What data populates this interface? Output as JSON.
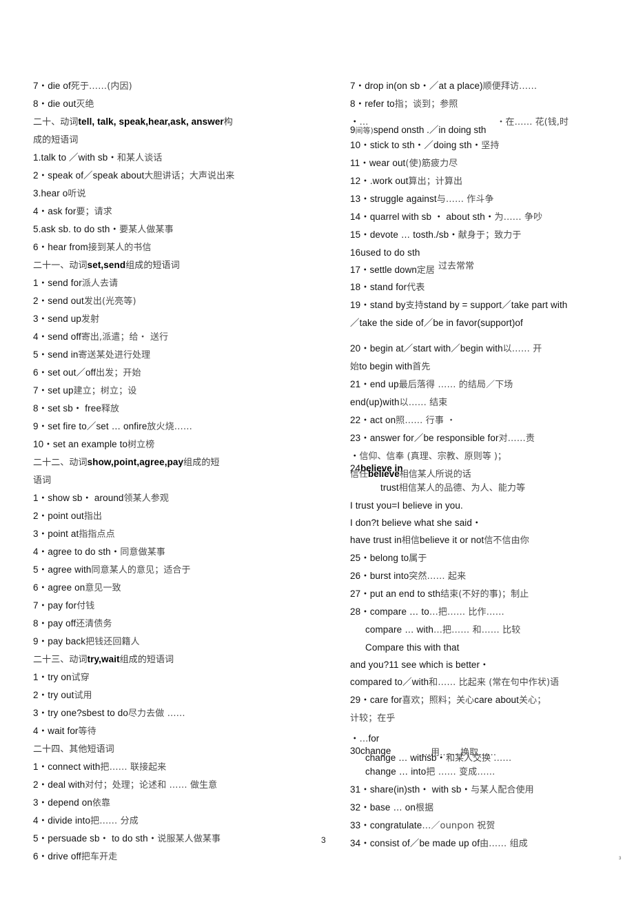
{
  "document": {
    "page_number": "3",
    "edge_marker": "3"
  },
  "left_column": [
    {
      "kind": "item",
      "num": "7・",
      "en": "die of",
      "cn": "死于……(内因)"
    },
    {
      "kind": "item",
      "num": "8・",
      "en": "die out",
      "cn": "灭绝"
    },
    {
      "kind": "heading",
      "cn_pre": "二十、动词",
      "bold": "tell, talk, speak,hear,ask, answer",
      "cn_post": "构"
    },
    {
      "kind": "heading_cont",
      "cn": "成的短语词"
    },
    {
      "kind": "item",
      "num": "1.",
      "en": "talk to ／with sb・",
      "cn": "和某人谈话"
    },
    {
      "kind": "item",
      "num": "2・",
      "en": "speak of／speak about",
      "cn": "大胆讲话；大声说出来"
    },
    {
      "kind": "item",
      "num": "3.",
      "en": "hear o",
      "cn": "听说"
    },
    {
      "kind": "item",
      "num": "4・",
      "en": "ask for",
      "cn": "要；请求"
    },
    {
      "kind": "item",
      "num": "5.",
      "en": "ask sb. to do sth・",
      "cn": "要某人做某事"
    },
    {
      "kind": "item",
      "num": "6・",
      "en": "hear from",
      "cn": "接到某人的书信"
    },
    {
      "kind": "heading",
      "cn_pre": "二十一、动词",
      "bold": "set,send",
      "cn_post": "组成的短语词"
    },
    {
      "kind": "item",
      "num": "1・",
      "en": "send for",
      "cn": "派人去请"
    },
    {
      "kind": "item",
      "num": "2・",
      "en": "send out",
      "cn": "发出(光亮等)"
    },
    {
      "kind": "item",
      "num": "3・",
      "en": "send up",
      "cn": "发射"
    },
    {
      "kind": "item",
      "num": "4・",
      "en": "send off",
      "cn": "寄出,派遣；给・ 送行"
    },
    {
      "kind": "item",
      "num": "5・",
      "en": "send in",
      "cn": "寄送某处进行处理"
    },
    {
      "kind": "item",
      "num": "6・",
      "en": "set out／off",
      "cn": "出发；开始"
    },
    {
      "kind": "item",
      "num": "7・",
      "en": "set up",
      "cn": "建立；树立；设"
    },
    {
      "kind": "item",
      "num": "8・",
      "en": "set sb・ free",
      "cn": "释放"
    },
    {
      "kind": "item",
      "num": "9・",
      "en": "set fire to／set … onfire",
      "cn": "放火烧……"
    },
    {
      "kind": "item",
      "num": "10・",
      "en": "set an example to",
      "cn": "树立榜"
    },
    {
      "kind": "heading",
      "cn_pre": "二十二、动词",
      "bold": "show,point,agree,pay",
      "cn_post": "组成的短"
    },
    {
      "kind": "heading_cont",
      "cn": "语词"
    },
    {
      "kind": "item",
      "num": "1・",
      "en": "show sb・ around",
      "cn": "领某人参观"
    },
    {
      "kind": "item",
      "num": "2・",
      "en": "point out",
      "cn": "指出"
    },
    {
      "kind": "item",
      "num": "3・",
      "en": "point at",
      "cn": "指指点点"
    },
    {
      "kind": "item",
      "num": "4・",
      "en": "agree to do sth・",
      "cn": "同意做某事"
    },
    {
      "kind": "item",
      "num": "5・",
      "en": "agree with",
      "cn": "同意某人的意见；适合于"
    },
    {
      "kind": "item",
      "num": "6・",
      "en": "agree on",
      "cn": "意见一致"
    },
    {
      "kind": "item",
      "num": "7・",
      "en": "pay for",
      "cn": "付钱"
    },
    {
      "kind": "item",
      "num": "8・",
      "en": "pay off",
      "cn": "还清债务"
    },
    {
      "kind": "item",
      "num": "9・",
      "en": "pay back",
      "cn": "把钱还回籍人"
    },
    {
      "kind": "heading",
      "cn_pre": "二十三、动词",
      "bold": "try,wait",
      "cn_post": "组成的短语词"
    },
    {
      "kind": "item",
      "num": "1・",
      "en": "try on",
      "cn": "试穿"
    },
    {
      "kind": "item",
      "num": "2・",
      "en": "try out",
      "cn": "试用"
    },
    {
      "kind": "item",
      "num": "3・",
      "en": "try one?sbest to do",
      "cn": "尽力去做 ……"
    },
    {
      "kind": "item",
      "num": "4・",
      "en": "wait for",
      "cn": "等待"
    },
    {
      "kind": "heading",
      "cn_pre": "二十四、其他短语词",
      "bold": "",
      "cn_post": ""
    },
    {
      "kind": "item",
      "num": "1・",
      "en": "connect with",
      "cn": "把…… 联接起来"
    },
    {
      "kind": "item",
      "num": "2・",
      "en": "deal with",
      "cn": "对付；处理；论述和 …… 做生意"
    },
    {
      "kind": "item",
      "num": "3・",
      "en": "depend on",
      "cn": "依靠"
    },
    {
      "kind": "item",
      "num": "4・",
      "en": "divide into",
      "cn": "把…… 分成"
    },
    {
      "kind": "item",
      "num": "5・",
      "en": "persuade sb・ to do sth・",
      "cn": "说服某人做某事"
    },
    {
      "kind": "item",
      "num": "6・",
      "en": "drive off",
      "cn": "把车开走"
    }
  ],
  "right_column": [
    {
      "kind": "item",
      "num": "7・",
      "en": "drop in(on sb・／at a place)",
      "cn": "顺便拜访……"
    },
    {
      "kind": "item",
      "num": "8・",
      "en": "refer to",
      "cn": "指；谈到；参照"
    },
    {
      "kind": "overlap",
      "top": {
        "dots": "・",
        "dots2": "…",
        "cn": "・在…… 花(钱,时"
      },
      "bottom": {
        "num": "9",
        "cn_small": "间等)",
        "en": "spend    onsth .／in doing sth"
      }
    },
    {
      "kind": "item",
      "num": "10・",
      "en": "stick to sth・／doing sth・",
      "cn": "坚持"
    },
    {
      "kind": "item",
      "num": "11・",
      "en": "wear out",
      "cn": "(使)筋疲力尽"
    },
    {
      "kind": "item",
      "num": "12・",
      "en": ".work out",
      "cn": "算出；计算出"
    },
    {
      "kind": "item",
      "num": "13・",
      "en": "struggle against",
      "cn": "与…… 作斗争"
    },
    {
      "kind": "item",
      "num": "14・",
      "en": "quarrel with sb ・ about sth・",
      "cn": "为…… 争吵"
    },
    {
      "kind": "item",
      "num": "15・",
      "en": "devote … tosth./sb・",
      "cn": "献身于；致力于"
    },
    {
      "kind": "item",
      "num": "16",
      "en": "used to do sth",
      "cn": ""
    },
    {
      "kind": "overlap17",
      "num": "17・",
      "en": "settle down",
      "cn_under": "定居",
      "cn_over": "过去常常"
    },
    {
      "kind": "item",
      "num": "18・",
      "en": "stand for",
      "cn": "代表"
    },
    {
      "kind": "item",
      "num": "19・",
      "en": "stand by",
      "cn": "支持",
      "en2": "stand by = support／take part with"
    },
    {
      "kind": "cont",
      "en": "／take the side of／be in favor(support)of"
    },
    {
      "kind": "gap"
    },
    {
      "kind": "item",
      "num": "20・",
      "en": "begin at／start with／begin with",
      "cn": "以…… 开"
    },
    {
      "kind": "cont2",
      "cn": "始",
      "en": "to begin with",
      "cn2": "首先"
    },
    {
      "kind": "item",
      "num": "21・",
      "en": "end up",
      "cn": "最后落得 …… 的结局／下场"
    },
    {
      "kind": "plain",
      "en": "end(up)with",
      "cn": "以…… 结束"
    },
    {
      "kind": "item",
      "num": "22・",
      "en": "act on",
      "cn": "照…… 行事  ・"
    },
    {
      "kind": "item",
      "num": "23・",
      "en": "answer for／be responsible for",
      "cn": "对……责"
    },
    {
      "kind": "overlap24",
      "dots": "・",
      "cn_top": "信仰、信奉 (真理、宗教、原则等    )；",
      "num": "24",
      "en_a": "believe in",
      "cn_left": "信任",
      "en_b": "believe",
      "cn_b": "相信某人所说的话"
    },
    {
      "kind": "cont3",
      "en": "trust",
      "cn": "相信某人的品德、为人、能力等"
    },
    {
      "kind": "plain",
      "en": "I trust you=I believe in you.",
      "cn": ""
    },
    {
      "kind": "plain",
      "en": "I don?t believe what she said・",
      "cn": ""
    },
    {
      "kind": "plain2",
      "en": "have trust in",
      "cn": "相信",
      "en2": "believe it or not",
      "cn2": "信不信由你"
    },
    {
      "kind": "item",
      "num": "25・",
      "en": "belong to",
      "cn": "属于"
    },
    {
      "kind": "item",
      "num": "26・",
      "en": "burst into",
      "cn": "突然…… 起来"
    },
    {
      "kind": "item",
      "num": "27・",
      "en": "put an end to sth",
      "cn": "结束(不好的事)；制止"
    },
    {
      "kind": "item",
      "num": "28・",
      "en": "compare … to",
      "cn": "…把…… 比作……"
    },
    {
      "kind": "cont4",
      "en": "compare … with",
      "cn": "…把…… 和…… 比较"
    },
    {
      "kind": "cont5",
      "en": "Compare this with that"
    },
    {
      "kind": "plain",
      "en": "and you?11 see which is better・",
      "cn": ""
    },
    {
      "kind": "plain",
      "en": "compared to／with",
      "cn": "和…… 比起来 (常在句中作状)语"
    },
    {
      "kind": "item",
      "num": "29・",
      "en": "care for",
      "cn": "喜欢；照料；关心",
      "en2": "care about",
      "cn2": "关心；"
    },
    {
      "kind": "plain",
      "en": "",
      "cn": "计较；在乎"
    },
    {
      "kind": "overlap30",
      "dots": "・",
      "dots2": "…",
      "en_for": "for",
      "num": "30",
      "en_a": "change",
      "en_b": "change … withsb・",
      "cn_a": "…用…… 换取……",
      "cn_b": "和某人交换 ……"
    },
    {
      "kind": "cont6",
      "en": "change … into",
      "cn": "把 …… 变成……"
    },
    {
      "kind": "item",
      "num": "31・",
      "en": "share(in)sth・ with sb・",
      "cn": "与某人配合使用"
    },
    {
      "kind": "item",
      "num": "32・",
      "en": "base … on",
      "cn": "根据"
    },
    {
      "kind": "item",
      "num": "33・",
      "en": "congratulate",
      "cn": "…／ounpon 祝贺",
      "bold_part": "ounpon"
    },
    {
      "kind": "item",
      "num": "34・",
      "en": "consist of／be made up of",
      "cn": "由…… 组成"
    }
  ]
}
